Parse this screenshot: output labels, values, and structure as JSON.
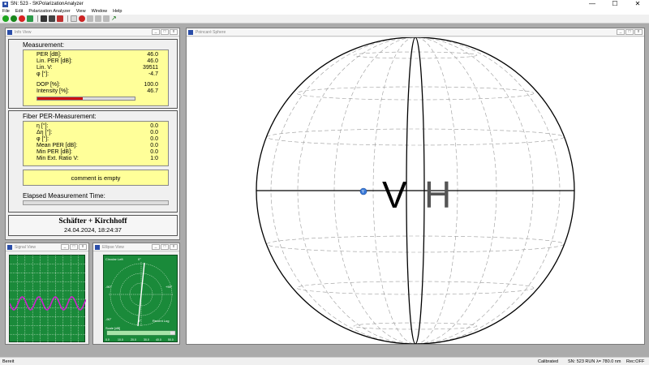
{
  "window": {
    "title": "SN: 523 - SKPolarizationAnalyzer",
    "controls": [
      "—",
      "☐",
      "✕"
    ]
  },
  "menu": [
    "File",
    "Edit",
    "Polarization Analyzer",
    "View",
    "Window",
    "Help"
  ],
  "info_view": {
    "title": "Info View",
    "measurement": {
      "title": "Measurement:",
      "rows": [
        {
          "label": "PER [dB]:",
          "value": "46.0"
        },
        {
          "label": "Lin. PER [dB]:",
          "value": "46.0"
        },
        {
          "label": "Lin. V:",
          "value": "39511"
        },
        {
          "label": "φ [°]:",
          "value": "-4.7"
        },
        {
          "label": "DOP [%]:",
          "value": "100.0"
        },
        {
          "label": "Intensity [%]:",
          "value": "46.7"
        }
      ],
      "intensity_fraction": 0.467
    },
    "fiber": {
      "title": "Fiber PER-Measurement:",
      "rows": [
        {
          "label": "η [°]:",
          "value": "0.0"
        },
        {
          "label": "Δη [°]:",
          "value": "0.0"
        },
        {
          "label": "φ [°]:",
          "value": "0.0"
        },
        {
          "label": "Mean PER [dB]:",
          "value": "0.0"
        },
        {
          "label": "Min  PER [dB]:",
          "value": "0.0"
        },
        {
          "label": "Min Ext. Ratio V:",
          "value": "1:0"
        }
      ],
      "comment": "comment is empty",
      "elapsed_label": "Elapsed Measurement Time:"
    },
    "brand": "Schäfter + Kirchhoff",
    "datetime": "24.04.2024, 18:24:37"
  },
  "signal_view": {
    "title": "Signal View"
  },
  "ellipse_view": {
    "title": "Ellipse View",
    "circ_label": "Circular Left",
    "tick_top": "0°",
    "tick_left": "-90°",
    "tick_right": "+90°",
    "tick_bl": "-90°",
    "tick_bottom": "0°",
    "log_label": "Recent  Log",
    "range_label": "Scale [dB]",
    "scale_ticks": [
      "0.0",
      "10.0",
      "20.0",
      "30.0",
      "40.0",
      "50.0"
    ]
  },
  "sphere_view": {
    "title": "Poincaré Sphere",
    "v_label": "V",
    "h_label": "H",
    "marker_label": "Y"
  },
  "child_buttons": [
    "_",
    "□",
    "x"
  ],
  "status": {
    "left": "Bereit",
    "calibrated": "Calibrated",
    "sn": "SN: 523 RUN",
    "lambda": "λ= 780.0 nm",
    "rec": "Rec:OFF"
  },
  "colors": {
    "signal_trace": "#d020d0",
    "scope_bg": "#1a8a3a",
    "intensity_fill": "#d01010",
    "panel_yellow": "#ffff99"
  }
}
